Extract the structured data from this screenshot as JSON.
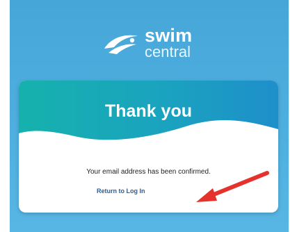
{
  "logo": {
    "icon": "swimmer-swoosh-icon",
    "word1": "swim",
    "word2": "central"
  },
  "card": {
    "title": "Thank you",
    "message": "Your email address has been confirmed.",
    "link_label": "Return to Log In"
  },
  "annotation": {
    "icon": "red-arrow-icon"
  },
  "colors": {
    "background": "#4fb0e0",
    "header_teal": "#18aeb1",
    "header_blue": "#1e8fca",
    "link": "#2a5f96",
    "arrow": "#e5322d"
  }
}
